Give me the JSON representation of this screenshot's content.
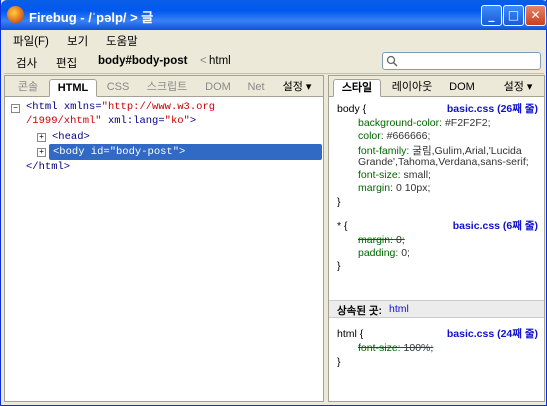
{
  "window": {
    "title": "Firebug - /ˈpəlp/ > 글",
    "min": "_",
    "max": "□",
    "close": "✕"
  },
  "menu": {
    "file": "파일(F)",
    "view": "보기",
    "help": "도움말"
  },
  "toolbar": {
    "inspect": "검사",
    "edit": "편집",
    "breadcrumb_current": "body#body-post",
    "breadcrumb_sep": "<",
    "breadcrumb_parent": "html",
    "search_value": ""
  },
  "left_tabs": {
    "console": "콘솔",
    "html": "HTML",
    "css": "CSS",
    "script": "스크립트",
    "dom": "DOM",
    "net": "Net",
    "options": "설정 ▾"
  },
  "right_tabs": {
    "style": "스타일",
    "layout": "레이아웃",
    "dom": "DOM",
    "options": "설정 ▾"
  },
  "html_tree": {
    "html_open": "<html",
    "html_attr_name": "xmlns=",
    "html_attr_value_1": "\"http://www.w3.org",
    "html_attr_value_2": "/1999/xhtml\"",
    "lang_attr": "xml:lang=",
    "lang_value": "\"ko\"",
    "html_close_bracket": ">",
    "head": "<head>",
    "body_selected": "<body id=\"body-post\">",
    "html_close": "</html>"
  },
  "css": {
    "rule1": {
      "selector": "body {",
      "source": "basic.css (26째 줄)",
      "props": [
        {
          "name": "background-color:",
          "value": "#F2F2F2;"
        },
        {
          "name": "color:",
          "value": "#666666;"
        },
        {
          "name": "font-family:",
          "value": "굴림,Gulim,Arial,'Lucida"
        },
        {
          "name": "",
          "value": "Grande',Tahoma,Verdana,sans-serif;"
        },
        {
          "name": "font-size:",
          "value": "small;"
        },
        {
          "name": "margin:",
          "value": "0 10px;"
        }
      ],
      "close": "}"
    },
    "rule2": {
      "selector": "* {",
      "source": "basic.css (6째 줄)",
      "props": [
        {
          "name": "margin:",
          "value": "0;"
        },
        {
          "name": "padding:",
          "value": "0;"
        }
      ],
      "close": "}"
    },
    "inherited_label": "상속된 곳:",
    "inherited_target": "html",
    "rule3": {
      "selector": "html {",
      "source": "basic.css (24째 줄)",
      "props": [
        {
          "name": "font-size:",
          "value": "100%;"
        }
      ],
      "close": "}"
    }
  }
}
